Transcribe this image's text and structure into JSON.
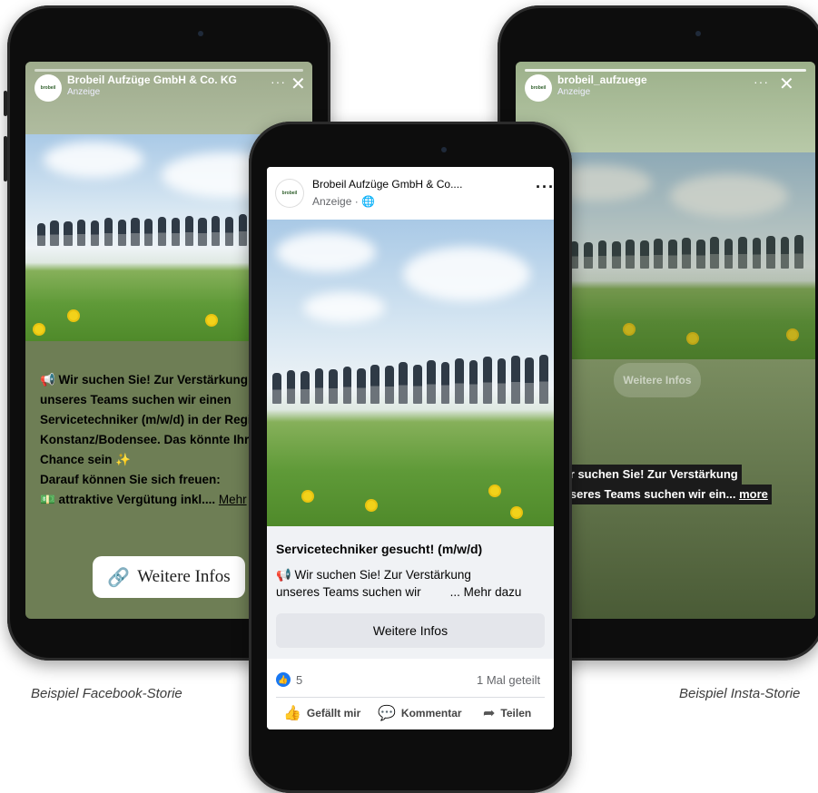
{
  "left_story": {
    "page_name": "Brobeil Aufzüge GmbH & Co. KG",
    "sponsored": "Anzeige",
    "menu": "···",
    "close": "✕",
    "text_lines": [
      "📢 Wir suchen Sie! Zur Verstärkung",
      "unseres Teams suchen wir einen",
      "Servicetechniker (m/w/d) in der Region",
      "Konstanz/Bodensee. Das könnte Ihre",
      "Chance sein ✨",
      "Darauf können Sie sich freuen:",
      "💵 attraktive Vergütung inkl.... "
    ],
    "more_link": "Mehr",
    "cta": "Weitere Infos",
    "cta_icon": "link-icon"
  },
  "center_post": {
    "page_name": "Brobeil Aufzüge GmbH & Co....",
    "sponsored": "Anzeige · 🌐",
    "menu": "···",
    "logo_text": "brobeil",
    "headline": "Servicetechniker gesucht! (m/w/d)",
    "body_line1": "📢 Wir suchen Sie! Zur Verstärkung",
    "body_line2": "unseres Teams suchen wir",
    "more_link": "... Mehr dazu",
    "cta": "Weitere Infos",
    "reactions": "5",
    "shares": "1 Mal geteilt",
    "actions": {
      "like": "Gefällt mir",
      "comment": "Kommentar",
      "share": "Teilen"
    }
  },
  "right_story": {
    "username": "brobeil_aufzuege",
    "sponsored": "Anzeige",
    "menu": "···",
    "close": "✕",
    "cta": "Weitere Infos",
    "caption_line1": "Wir suchen Sie! Zur Verstärkung",
    "caption_line2": "unseres Teams suchen wir ein... ",
    "more_link": "more"
  },
  "captions": {
    "left": "Beispiel Facebook-Storie",
    "right": "Beispiel Insta-Storie"
  },
  "colors": {
    "facebook_blue": "#1877f2",
    "story_green": "#6e7e55",
    "link_blue": "#2a6dd8"
  }
}
